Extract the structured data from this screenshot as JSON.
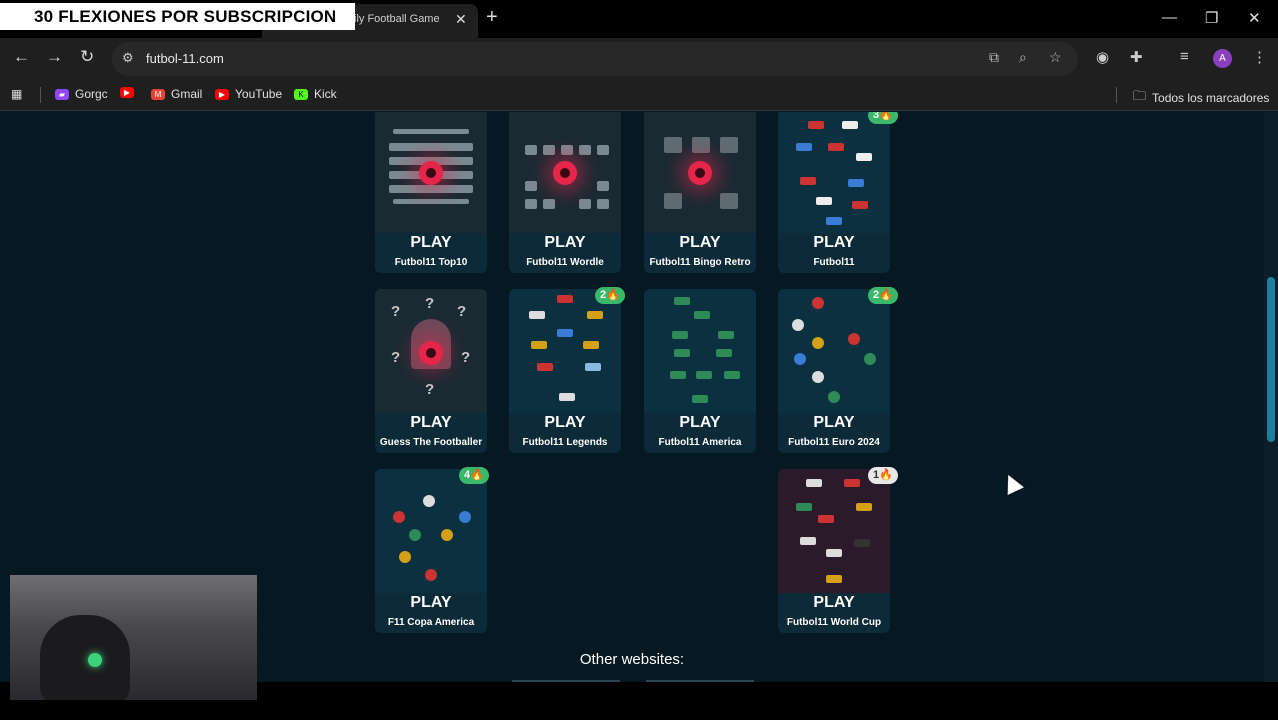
{
  "overlay_banner": "30 FLEXIONES POR SUBSCRIPCION",
  "tab": {
    "title": "ily Football Game"
  },
  "address_bar": {
    "url": "futbol-11.com"
  },
  "profile_initial": "A",
  "bookmarks": {
    "items": [
      {
        "label": "Gorgc",
        "icon": "twitch-icon",
        "color": "#9146ff"
      },
      {
        "label": "",
        "icon": "youtube-icon",
        "color": "#ff0000"
      },
      {
        "label": "Gmail",
        "icon": "gmail-icon",
        "color": "#ea4335"
      },
      {
        "label": "YouTube",
        "icon": "youtube-icon",
        "color": "#ff0000"
      },
      {
        "label": "Kick",
        "icon": "kick-icon",
        "color": "#53fc18"
      }
    ],
    "all_bookmarks": "Todos los marcadores"
  },
  "games": [
    {
      "play": "PLAY",
      "name": "Futbol11 Top10",
      "badge": ""
    },
    {
      "play": "PLAY",
      "name": "Futbol11 Wordle",
      "badge": ""
    },
    {
      "play": "PLAY",
      "name": "Futbol11 Bingo Retro",
      "badge": ""
    },
    {
      "play": "PLAY",
      "name": "Futbol11",
      "badge": "3🔥"
    },
    {
      "play": "PLAY",
      "name": "Guess The Footballer",
      "badge": ""
    },
    {
      "play": "PLAY",
      "name": "Futbol11 Legends",
      "badge": "2🔥"
    },
    {
      "play": "PLAY",
      "name": "Futbol11 America",
      "badge": ""
    },
    {
      "play": "PLAY",
      "name": "Futbol11 Euro 2024",
      "badge": "2🔥"
    },
    {
      "play": "PLAY",
      "name": "F11 Copa America",
      "badge": "4🔥"
    },
    {
      "play": "PLAY",
      "name": "Futbol11 World Cup",
      "badge": "1🔥"
    }
  ],
  "other_websites": "Other websites:",
  "colors": {
    "page_bg": "#061821",
    "card_bg": "#0c2330",
    "badge_green": "#3ab86a",
    "accent_red": "#e5254a"
  }
}
